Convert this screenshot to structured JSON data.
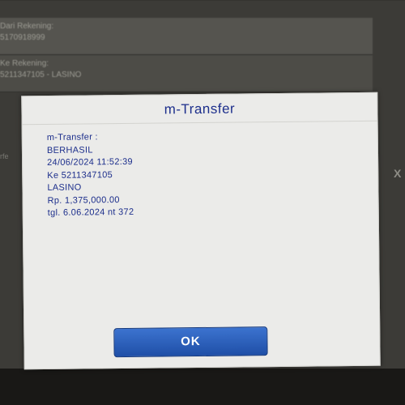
{
  "background": {
    "rows": [
      {
        "label": "Dari Rekening:",
        "value": "5170918999"
      },
      {
        "label": "Ke Rekening:",
        "value": "5211347105 - LASINO"
      }
    ],
    "close_glyph": "X",
    "left_fragment": "rfe"
  },
  "dialog": {
    "title": "m-Transfer",
    "lines": [
      "m-Transfer :",
      "BERHASIL",
      "24/06/2024 11:52:39",
      "Ke 5211347105",
      "LASINO",
      "Rp. 1,375,000.00",
      "tgl. 6.06.2024 nt 372"
    ],
    "ok_label": "OK"
  },
  "colors": {
    "title": "#1d2f8c",
    "ok_button": "#2a5dba",
    "dialog_bg": "#ebebe9"
  }
}
